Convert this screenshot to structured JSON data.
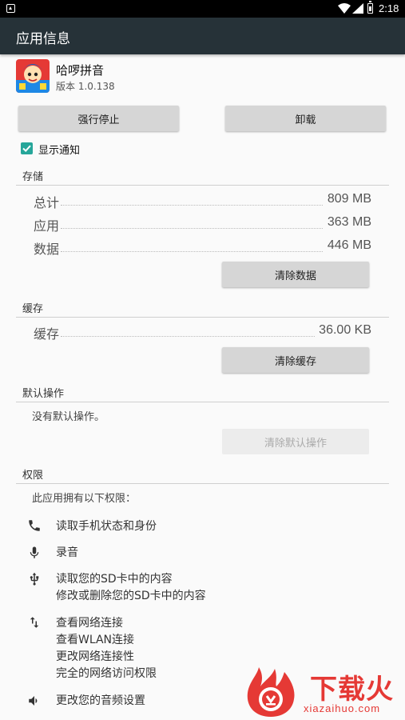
{
  "status_bar": {
    "time": "2:18"
  },
  "app_bar": {
    "title": "应用信息"
  },
  "app": {
    "name": "哈啰拼音",
    "version": "版本 1.0.138"
  },
  "buttons": {
    "force_stop": "强行停止",
    "uninstall": "卸载"
  },
  "notifications": {
    "label": "显示通知",
    "checked": true
  },
  "storage": {
    "title": "存储",
    "rows": [
      {
        "label": "总计",
        "value": "809 MB"
      },
      {
        "label": "应用",
        "value": "363 MB"
      },
      {
        "label": "数据",
        "value": "446 MB"
      }
    ],
    "clear_button": "清除数据"
  },
  "cache": {
    "title": "缓存",
    "rows": [
      {
        "label": "缓存",
        "value": "36.00 KB"
      }
    ],
    "clear_button": "清除缓存"
  },
  "defaults": {
    "title": "默认操作",
    "text": "没有默认操作。",
    "clear_button": "清除默认操作"
  },
  "permissions": {
    "title": "权限",
    "intro": "此应用拥有以下权限：",
    "groups": [
      {
        "icon": "phone-icon",
        "lines": [
          "读取手机状态和身份"
        ]
      },
      {
        "icon": "mic-icon",
        "lines": [
          "录音"
        ]
      },
      {
        "icon": "usb-icon",
        "lines": [
          "读取您的SD卡中的内容",
          "修改或删除您的SD卡中的内容"
        ]
      },
      {
        "icon": "swap-vertical-icon",
        "lines": [
          "查看网络连接",
          "查看WLAN连接",
          "更改网络连接性",
          "完全的网络访问权限"
        ]
      },
      {
        "icon": "volume-icon",
        "lines": [
          "更改您的音频设置"
        ]
      }
    ]
  },
  "watermark": {
    "title": "下载火",
    "url": "xiazaihuo.com"
  },
  "colors": {
    "app_bar": "#263238",
    "accent": "#26a69a",
    "watermark": "#e53935"
  }
}
